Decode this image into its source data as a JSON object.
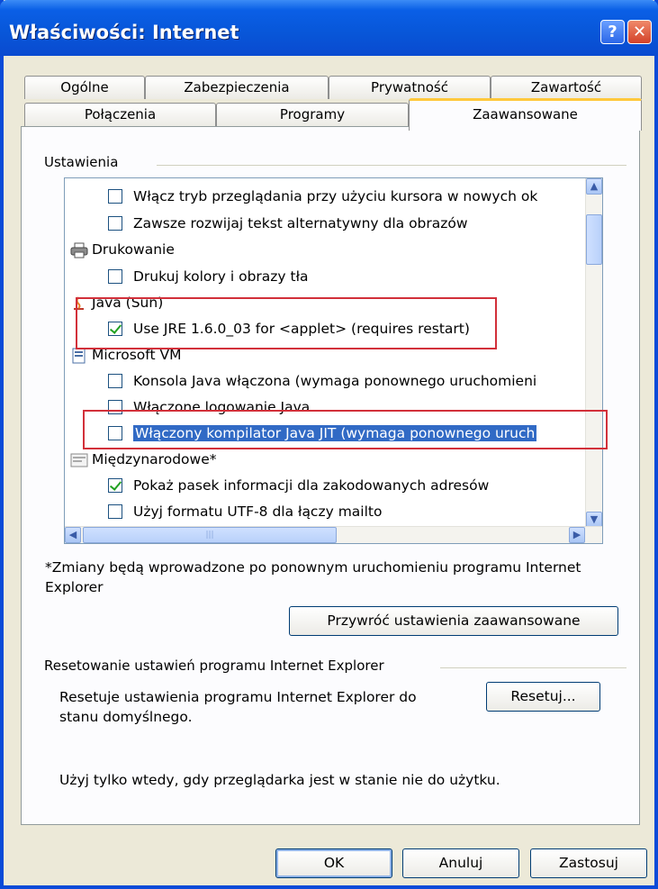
{
  "window": {
    "title": "Właściwości: Internet",
    "help_glyph": "?",
    "close_glyph": "✕"
  },
  "tabs_back": [
    "Ogólne",
    "Zabezpieczenia",
    "Prywatność",
    "Zawartość"
  ],
  "tabs_front": [
    "Połączenia",
    "Programy",
    "Zaawansowane"
  ],
  "settings": {
    "group_label": "Ustawienia",
    "items": [
      {
        "kind": "checkbox",
        "checked": false,
        "label": "Włącz tryb przeglądania przy użyciu kursora w nowych ok"
      },
      {
        "kind": "checkbox",
        "checked": false,
        "label": "Zawsze rozwijaj tekst alternatywny dla obrazów"
      },
      {
        "kind": "category",
        "icon": "printer-icon",
        "label": "Drukowanie"
      },
      {
        "kind": "checkbox",
        "checked": false,
        "label": "Drukuj kolory i obrazy tła"
      },
      {
        "kind": "category",
        "icon": "java-icon",
        "label": "Java (Sun)"
      },
      {
        "kind": "checkbox",
        "checked": true,
        "label": "Use JRE 1.6.0_03 for <applet> (requires restart)"
      },
      {
        "kind": "category",
        "icon": "microsoft-vm-icon",
        "label": "Microsoft VM"
      },
      {
        "kind": "checkbox",
        "checked": false,
        "label": "Konsola Java włączona (wymaga ponownego uruchomieni"
      },
      {
        "kind": "checkbox",
        "checked": false,
        "label": "Włączone logowanie Java"
      },
      {
        "kind": "checkbox",
        "checked": false,
        "selected": true,
        "label": "Włączony kompilator Java JIT (wymaga ponownego uruch"
      },
      {
        "kind": "category",
        "icon": "international-icon",
        "label": "Międzynarodowe*"
      },
      {
        "kind": "checkbox",
        "checked": true,
        "label": "Pokaż pasek informacji dla zakodowanych adresów"
      },
      {
        "kind": "checkbox",
        "checked": false,
        "label": "Użyj formatu UTF-8 dla łączy mailto"
      }
    ],
    "note": "*Zmiany będą wprowadzone po ponownym uruchomieniu programu Internet Explorer",
    "restore_button": "Przywróć ustawienia zaawansowane"
  },
  "reset": {
    "group_label": "Resetowanie ustawień programu Internet Explorer",
    "description": "Resetuje ustawienia programu Internet Explorer do stanu domyślnego.",
    "button": "Resetuj...",
    "warning": "Użyj tylko wtedy, gdy przeglądarka jest w stanie nie do użytku."
  },
  "footer": {
    "ok": "OK",
    "cancel": "Anuluj",
    "apply": "Zastosuj"
  },
  "colors": {
    "title_bar": "#0856d8",
    "selection": "#316ac5",
    "highlight_box": "#d2303a",
    "active_tab_accent": "#ffc83c"
  }
}
